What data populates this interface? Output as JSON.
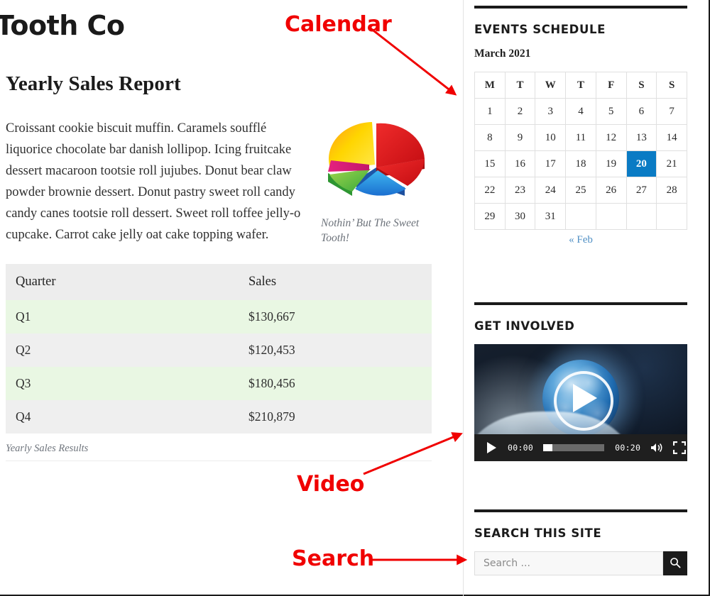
{
  "site": {
    "title": "Tooth Co"
  },
  "article": {
    "heading": "Yearly Sales Report",
    "body": "Croissant cookie biscuit muffin. Caramels soufflé liquorice chocolate bar danish lollipop. Icing fruitcake dessert macaroon tootsie roll jujubes. Donut bear claw powder brownie dessert. Donut pastry sweet roll candy candy canes tootsie roll dessert. Sweet roll toffee jelly-o cupcake. Carrot cake jelly oat cake topping wafer.",
    "figure": {
      "caption": "Nothin’ But The Sweet Tooth!",
      "icon": "pie-chart-image"
    },
    "table": {
      "caption": "Yearly Sales Results",
      "columns": [
        "Quarter",
        "Sales"
      ],
      "rows": [
        [
          "Q1",
          "$130,667"
        ],
        [
          "Q2",
          "$120,453"
        ],
        [
          "Q3",
          "$180,456"
        ],
        [
          "Q4",
          "$210,879"
        ]
      ]
    }
  },
  "sidebar": {
    "events": {
      "title": "EVENTS SCHEDULE",
      "month": "March 2021",
      "weekdays": [
        "M",
        "T",
        "W",
        "T",
        "F",
        "S",
        "S"
      ],
      "weeks": [
        [
          "1",
          "2",
          "3",
          "4",
          "5",
          "6",
          "7"
        ],
        [
          "8",
          "9",
          "10",
          "11",
          "12",
          "13",
          "14"
        ],
        [
          "15",
          "16",
          "17",
          "18",
          "19",
          "20",
          "21"
        ],
        [
          "22",
          "23",
          "24",
          "25",
          "26",
          "27",
          "28"
        ],
        [
          "29",
          "30",
          "31",
          "",
          "",
          "",
          ""
        ]
      ],
      "today": "20",
      "prev_link": "« Feb"
    },
    "video": {
      "title": "GET INVOLVED",
      "play_overlay_icon": "play-icon",
      "controls": {
        "play_icon": "play-icon",
        "current_time": "00:00",
        "duration": "00:20",
        "volume_icon": "volume-icon",
        "fullscreen_icon": "fullscreen-icon"
      }
    },
    "search": {
      "title": "SEARCH THIS SITE",
      "placeholder": "Search ...",
      "value": "",
      "button_icon": "search-icon"
    }
  },
  "annotations": [
    {
      "label": "Calendar"
    },
    {
      "label": "Video"
    },
    {
      "label": "Search"
    }
  ],
  "colors": {
    "accent_today": "#0a7bc4",
    "annotation_red": "#f00000",
    "rule_black": "#1a1a1a",
    "table_row_green": "#e9f7e3",
    "table_row_gray": "#efefef"
  }
}
